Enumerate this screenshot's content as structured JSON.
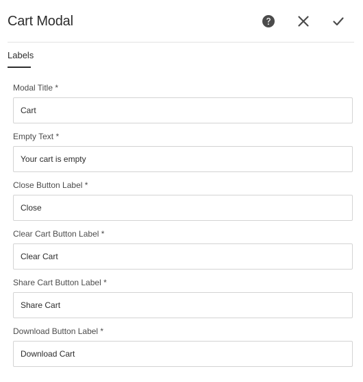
{
  "header": {
    "title": "Cart Modal"
  },
  "icons": {
    "help": "help-icon",
    "close": "close-icon",
    "done": "checkmark-icon"
  },
  "tabs": [
    {
      "label": "Labels",
      "active": true
    }
  ],
  "fields": [
    {
      "label": "Modal Title *",
      "value": "Cart"
    },
    {
      "label": "Empty Text *",
      "value": "Your cart is empty"
    },
    {
      "label": "Close Button Label *",
      "value": "Close"
    },
    {
      "label": "Clear Cart Button Label *",
      "value": "Clear Cart"
    },
    {
      "label": "Share Cart Button Label *",
      "value": "Share Cart"
    },
    {
      "label": "Download Button Label *",
      "value": "Download Cart"
    }
  ],
  "colors": {
    "text": "#2c2c2c",
    "icon": "#4b4b4b",
    "border": "#d3d3d3",
    "divider": "#e1e1e1"
  }
}
